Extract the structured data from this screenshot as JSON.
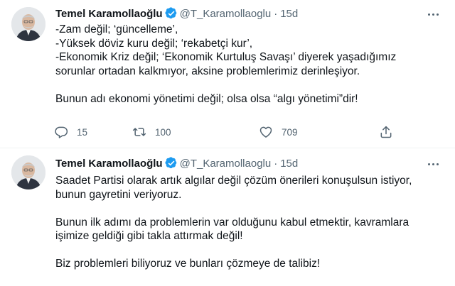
{
  "tweets": [
    {
      "author_name": "Temel Karamollaoğlu",
      "handle": "@T_Karamollaoglu",
      "separator": "·",
      "time": "15d",
      "lines": [
        "-Zam değil; ‘güncelleme’,",
        "-Yüksek döviz kuru değil; ‘rekabetçi kur’,",
        "-Ekonomik Kriz değil; ‘Ekonomik Kurtuluş Savaşı’ diyerek yaşadığımız",
        "sorunlar ortadan kalkmıyor, aksine problemlerimiz derinleşiyor.",
        "",
        "Bunun adı ekonomi yönetimi değil; olsa olsa “algı yönetimi”dir!"
      ],
      "replies": "15",
      "retweets": "100",
      "likes": "709"
    },
    {
      "author_name": "Temel Karamollaoğlu",
      "handle": "@T_Karamollaoglu",
      "separator": "·",
      "time": "15d",
      "lines": [
        "Saadet Partisi olarak artık algılar değil çözüm önerileri konuşulsun istiyor,",
        "bunun gayretini veriyoruz.",
        "",
        "Bunun ilk adımı da problemlerin var olduğunu kabul etmektir, kavramlara",
        "işimize geldiği gibi takla attırmak değil!",
        "",
        "Biz problemleri biliyoruz ve bunları çözmeye de talibiz!"
      ]
    }
  ],
  "icons": {
    "verified": "verified-badge-icon",
    "more": "more-icon",
    "reply": "reply-icon",
    "retweet": "retweet-icon",
    "like": "heart-icon",
    "share": "share-icon"
  },
  "colors": {
    "text": "#0f1419",
    "secondary": "#536471",
    "verified": "#1d9bf0",
    "divider": "#eff3f4"
  }
}
